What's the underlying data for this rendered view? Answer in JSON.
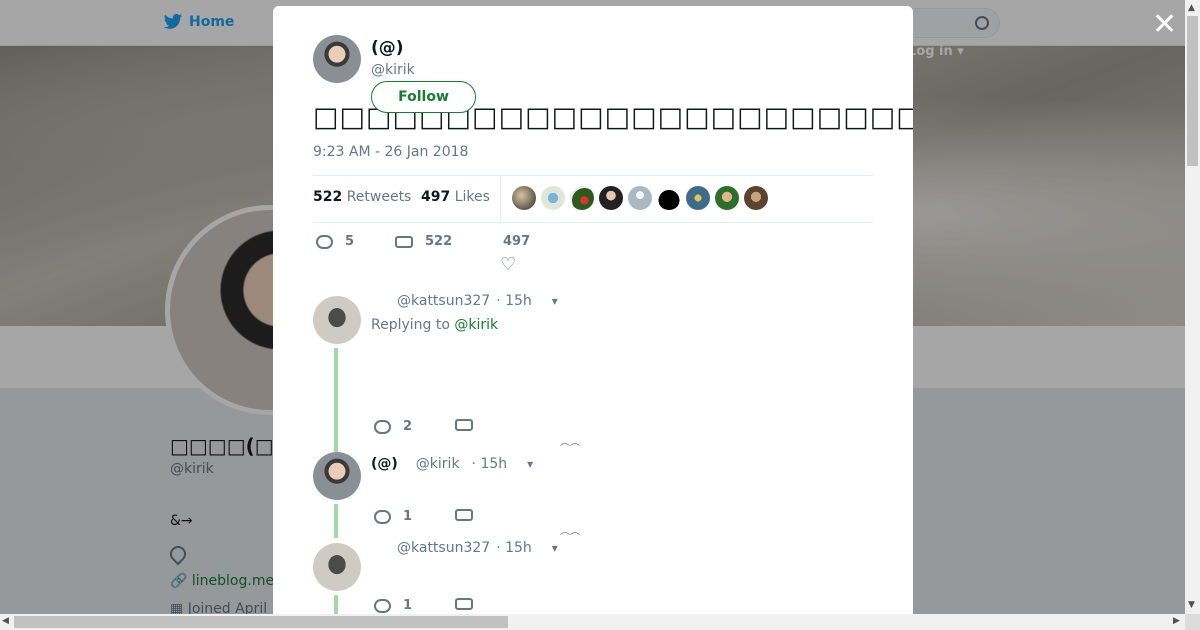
{
  "nav": {
    "home_label": "Home",
    "login_label": "Log in"
  },
  "profile": {
    "name": "□□□□(□□□□",
    "handle": "@kirik",
    "bio": "&→",
    "link": "lineblog.me",
    "joined": "Joined April"
  },
  "tweet": {
    "author_name": "(@)",
    "author_handle": "@kirik",
    "follow_label": "Follow",
    "text": "□□□□□□□□□□□□□□□□□□□□□□□□□□□□□□□□□□□□□□□□□□□□□□□",
    "timestamp": "9:23 AM - 26 Jan 2018",
    "retweets_count": "522",
    "retweets_label": "Retweets",
    "likes_count": "497",
    "likes_label": "Likes",
    "reply_count": "5",
    "retweet_action_count": "522",
    "like_action_count": "497"
  },
  "replies": [
    {
      "name": "",
      "handle": "@kattsun327",
      "time": "· 15h",
      "replying_prefix": "Replying to ",
      "replying_to": "@kirik",
      "reply_count": "2"
    },
    {
      "name": "(@)",
      "handle": "@kirik",
      "time": "· 15h",
      "reply_count": "1"
    },
    {
      "name": "",
      "handle": "@kattsun327",
      "time": "· 15h",
      "reply_count": "1"
    }
  ],
  "colors": {
    "accent": "#1b7a35",
    "thread": "#a3d9a5",
    "twitter_blue": "#1da1f2"
  },
  "icons": [
    "twitter-bird-icon",
    "search-icon",
    "close-icon",
    "reply-icon",
    "retweet-icon",
    "heart-icon",
    "chevron-down-icon",
    "location-icon",
    "link-icon",
    "calendar-icon"
  ]
}
